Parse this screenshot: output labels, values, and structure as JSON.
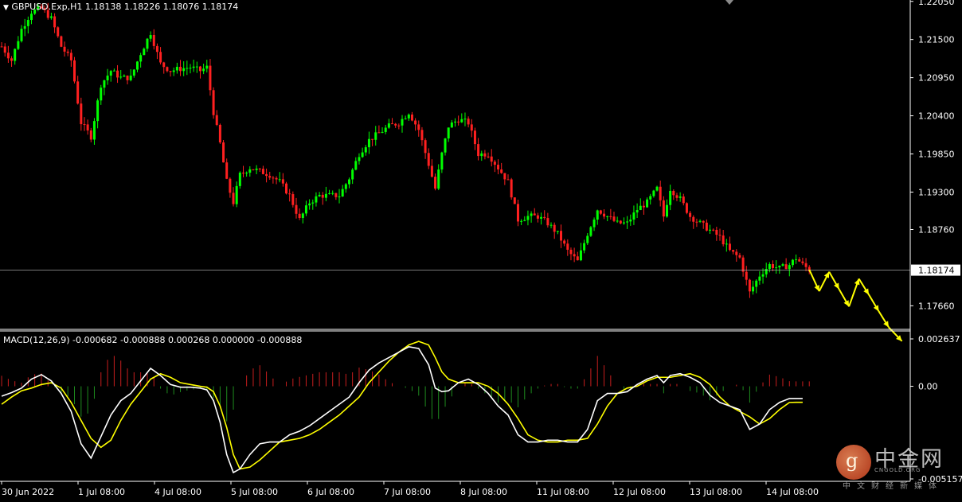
{
  "symbol_header": "GBPUSD.Exp,H1  1.18138 1.18226 1.18076 1.18174",
  "macd_header": "MACD(12,26,9) -0.000682 -0.000888 0.000268 0.000000 -0.000888",
  "current_price_label": "1.18174",
  "price_axis_labels": [
    "1.22050",
    "1.21500",
    "1.20950",
    "1.20400",
    "1.19850",
    "1.19300",
    "1.18760",
    "1.17660"
  ],
  "macd_axis_labels": [
    "0.002637",
    "0.00",
    "-0.005157"
  ],
  "time_labels": [
    "30 Jun 2022",
    "1 Jul 08:00",
    "4 Jul 08:00",
    "5 Jul 08:00",
    "6 Jul 08:00",
    "7 Jul 08:00",
    "8 Jul 08:00",
    "11 Jul 08:00",
    "12 Jul 08:00",
    "13 Jul 08:00",
    "14 Jul 08:00"
  ],
  "watermark": {
    "brand": "中金网",
    "glyph": "g",
    "domain": "CNGOLD.ORG",
    "slogan": "中文财经新媒体"
  },
  "colors": {
    "bull": "#00ff00",
    "bear": "#ff2020",
    "macd_main": "#ffffff",
    "macd_signal": "#ffff00",
    "hist_pos": "#c81e1e",
    "hist_neg": "#1e8c1e",
    "forecast": "#ffff00",
    "axis": "#ffffff",
    "price_line": "#c0c0c0"
  },
  "chart_data": [
    {
      "type": "candlestick",
      "title": "GBPUSD.Exp,H1",
      "y_axis_labels": [
        "1.22050",
        "1.21500",
        "1.20950",
        "1.20400",
        "1.19850",
        "1.19300",
        "1.18760",
        "1.17660"
      ],
      "ylim": [
        1.1732,
        1.2207
      ],
      "x_tick_labels": [
        "30 Jun 2022",
        "1 Jul 08:00",
        "4 Jul 08:00",
        "5 Jul 08:00",
        "6 Jul 08:00",
        "7 Jul 08:00",
        "8 Jul 08:00",
        "11 Jul 08:00",
        "12 Jul 08:00",
        "13 Jul 08:00",
        "14 Jul 08:00"
      ],
      "last_bar": {
        "open": 1.18138,
        "high": 1.18226,
        "low": 1.18076,
        "close": 1.18174
      },
      "current_price": 1.18174,
      "close_path": [
        [
          0,
          1.214
        ],
        [
          3,
          1.212
        ],
        [
          6,
          1.2165
        ],
        [
          9,
          1.219
        ],
        [
          12,
          1.2195
        ],
        [
          15,
          1.218
        ],
        [
          18,
          1.214
        ],
        [
          21,
          1.212
        ],
        [
          24,
          1.203
        ],
        [
          27,
          1.201
        ],
        [
          30,
          1.2085
        ],
        [
          33,
          1.2105
        ],
        [
          36,
          1.2095
        ],
        [
          39,
          1.2095
        ],
        [
          42,
          1.213
        ],
        [
          45,
          1.216
        ],
        [
          48,
          1.2115
        ],
        [
          51,
          1.2105
        ],
        [
          54,
          1.2108
        ],
        [
          57,
          1.211
        ],
        [
          60,
          1.2105
        ],
        [
          62,
          1.211
        ],
        [
          64,
          1.2045
        ],
        [
          66,
          1.2
        ],
        [
          68,
          1.1945
        ],
        [
          70,
          1.1915
        ],
        [
          72,
          1.1955
        ],
        [
          75,
          1.1965
        ],
        [
          78,
          1.196
        ],
        [
          81,
          1.1955
        ],
        [
          84,
          1.1945
        ],
        [
          87,
          1.1925
        ],
        [
          90,
          1.189
        ],
        [
          93,
          1.1915
        ],
        [
          96,
          1.1925
        ],
        [
          99,
          1.1925
        ],
        [
          102,
          1.1925
        ],
        [
          105,
          1.195
        ],
        [
          108,
          1.1985
        ],
        [
          111,
          1.2005
        ],
        [
          114,
          1.2015
        ],
        [
          117,
          1.2025
        ],
        [
          120,
          1.203
        ],
        [
          123,
          1.2045
        ],
        [
          126,
          1.202
        ],
        [
          129,
          1.197
        ],
        [
          131,
          1.1935
        ],
        [
          133,
          1.1985
        ],
        [
          135,
          1.2025
        ],
        [
          138,
          1.2035
        ],
        [
          141,
          1.203
        ],
        [
          144,
          1.1985
        ],
        [
          147,
          1.1985
        ],
        [
          150,
          1.1965
        ],
        [
          153,
          1.1945
        ],
        [
          156,
          1.189
        ],
        [
          159,
          1.1895
        ],
        [
          162,
          1.1895
        ],
        [
          165,
          1.1885
        ],
        [
          168,
          1.187
        ],
        [
          171,
          1.1845
        ],
        [
          174,
          1.183
        ],
        [
          177,
          1.187
        ],
        [
          180,
          1.1905
        ],
        [
          183,
          1.1895
        ],
        [
          186,
          1.1885
        ],
        [
          189,
          1.1885
        ],
        [
          192,
          1.1905
        ],
        [
          195,
          1.1915
        ],
        [
          198,
          1.1935
        ],
        [
          200,
          1.1895
        ],
        [
          202,
          1.1935
        ],
        [
          205,
          1.192
        ],
        [
          208,
          1.1895
        ],
        [
          211,
          1.1885
        ],
        [
          214,
          1.1875
        ],
        [
          217,
          1.1865
        ],
        [
          220,
          1.1845
        ],
        [
          223,
          1.1835
        ],
        [
          226,
          1.1785
        ],
        [
          229,
          1.181
        ],
        [
          232,
          1.1825
        ],
        [
          235,
          1.182
        ],
        [
          238,
          1.1825
        ],
        [
          240,
          1.1835
        ],
        [
          242,
          1.1825
        ],
        [
          244,
          1.1818
        ]
      ],
      "forecast_path": [
        [
          244,
          1.1818
        ],
        [
          247,
          1.1787
        ],
        [
          250,
          1.1815
        ],
        [
          253,
          1.179
        ],
        [
          256,
          1.1765
        ],
        [
          259,
          1.1805
        ],
        [
          262,
          1.1782
        ],
        [
          265,
          1.1758
        ],
        [
          268,
          1.1735
        ],
        [
          272,
          1.1715
        ]
      ]
    },
    {
      "type": "line",
      "title": "MACD(12,26,9)",
      "y_axis_labels": [
        "0.002637",
        "0.00",
        "-0.005157"
      ],
      "ylim": [
        -0.005157,
        0.002637
      ],
      "series": [
        {
          "name": "MACD",
          "values": [
            [
              0,
              -0.00055
            ],
            [
              3,
              -0.00035
            ],
            [
              6,
              -0.0001
            ],
            [
              9,
              0.0004
            ],
            [
              12,
              0.00065
            ],
            [
              15,
              0.0003
            ],
            [
              18,
              -0.0004
            ],
            [
              21,
              -0.0014
            ],
            [
              24,
              -0.0032
            ],
            [
              27,
              -0.004
            ],
            [
              30,
              -0.0028
            ],
            [
              33,
              -0.0016
            ],
            [
              36,
              -0.0008
            ],
            [
              39,
              -0.0004
            ],
            [
              42,
              0.0003
            ],
            [
              45,
              0.001
            ],
            [
              48,
              0.0006
            ],
            [
              51,
              0.0001
            ],
            [
              54,
              -5e-05
            ],
            [
              57,
              -5e-05
            ],
            [
              60,
              -0.0001
            ],
            [
              62,
              -0.0002
            ],
            [
              64,
              -0.0008
            ],
            [
              66,
              -0.002
            ],
            [
              68,
              -0.0038
            ],
            [
              70,
              -0.0048
            ],
            [
              72,
              -0.0046
            ],
            [
              75,
              -0.0038
            ],
            [
              78,
              -0.0032
            ],
            [
              81,
              -0.0031
            ],
            [
              84,
              -0.0031
            ],
            [
              87,
              -0.0027
            ],
            [
              90,
              -0.0025
            ],
            [
              93,
              -0.0022
            ],
            [
              96,
              -0.0018
            ],
            [
              99,
              -0.0014
            ],
            [
              102,
              -0.001
            ],
            [
              105,
              -0.0006
            ],
            [
              108,
              0.0002
            ],
            [
              111,
              0.0009
            ],
            [
              114,
              0.0013
            ],
            [
              117,
              0.0016
            ],
            [
              120,
              0.0019
            ],
            [
              123,
              0.0022
            ],
            [
              126,
              0.0021
            ],
            [
              129,
              0.0012
            ],
            [
              131,
              -0.0001
            ],
            [
              133,
              -0.0003
            ],
            [
              135,
              -0.00025
            ],
            [
              138,
              0.0002
            ],
            [
              141,
              0.0004
            ],
            [
              144,
              0.0001
            ],
            [
              147,
              -0.0004
            ],
            [
              150,
              -0.0011
            ],
            [
              153,
              -0.0016
            ],
            [
              156,
              -0.0027
            ],
            [
              159,
              -0.0031
            ],
            [
              162,
              -0.0031
            ],
            [
              165,
              -0.003
            ],
            [
              168,
              -0.003
            ],
            [
              171,
              -0.0031
            ],
            [
              174,
              -0.0031
            ],
            [
              177,
              -0.0024
            ],
            [
              180,
              -0.0008
            ],
            [
              183,
              -0.0004
            ],
            [
              186,
              -0.0004
            ],
            [
              189,
              -0.0003
            ],
            [
              192,
              0.0001
            ],
            [
              195,
              0.0004
            ],
            [
              198,
              0.0006
            ],
            [
              200,
              0.0002
            ],
            [
              202,
              0.0006
            ],
            [
              205,
              0.0007
            ],
            [
              208,
              0.0005
            ],
            [
              211,
              0.0002
            ],
            [
              214,
              -0.0005
            ],
            [
              217,
              -0.0009
            ],
            [
              220,
              -0.0011
            ],
            [
              223,
              -0.0013
            ],
            [
              226,
              -0.0024
            ],
            [
              229,
              -0.0021
            ],
            [
              232,
              -0.0013
            ],
            [
              235,
              -0.0009
            ],
            [
              238,
              -0.00068
            ],
            [
              240,
              -0.00068
            ],
            [
              242,
              -0.00068
            ]
          ]
        },
        {
          "name": "Signal",
          "values": [
            [
              0,
              -0.001
            ],
            [
              3,
              -0.0006
            ],
            [
              6,
              -0.00025
            ],
            [
              9,
              -0.0001
            ],
            [
              12,
              0.0001
            ],
            [
              15,
              0.0002
            ],
            [
              18,
              -0.0001
            ],
            [
              21,
              -0.0009
            ],
            [
              24,
              -0.0019
            ],
            [
              27,
              -0.0029
            ],
            [
              30,
              -0.0034
            ],
            [
              33,
              -0.003
            ],
            [
              36,
              -0.0019
            ],
            [
              39,
              -0.001
            ],
            [
              42,
              -0.0003
            ],
            [
              45,
              0.0004
            ],
            [
              48,
              0.0007
            ],
            [
              51,
              0.0005
            ],
            [
              54,
              0.0002
            ],
            [
              57,
              0.0001
            ],
            [
              60,
              0.0
            ],
            [
              62,
              -5e-05
            ],
            [
              64,
              -0.0003
            ],
            [
              66,
              -0.0011
            ],
            [
              68,
              -0.0023
            ],
            [
              70,
              -0.0038
            ],
            [
              72,
              -0.0046
            ],
            [
              75,
              -0.0045
            ],
            [
              78,
              -0.0041
            ],
            [
              81,
              -0.0036
            ],
            [
              84,
              -0.0031
            ],
            [
              87,
              -0.003
            ],
            [
              90,
              -0.0029
            ],
            [
              93,
              -0.0027
            ],
            [
              96,
              -0.0024
            ],
            [
              99,
              -0.002
            ],
            [
              102,
              -0.0016
            ],
            [
              105,
              -0.0011
            ],
            [
              108,
              -0.0006
            ],
            [
              111,
              0.0002
            ],
            [
              114,
              0.0008
            ],
            [
              117,
              0.0014
            ],
            [
              120,
              0.0019
            ],
            [
              123,
              0.0023
            ],
            [
              126,
              0.0025
            ],
            [
              129,
              0.0023
            ],
            [
              131,
              0.0016
            ],
            [
              133,
              0.0008
            ],
            [
              135,
              0.0004
            ],
            [
              138,
              0.0002
            ],
            [
              141,
              0.0002
            ],
            [
              144,
              0.0002
            ],
            [
              147,
              0.0
            ],
            [
              150,
              -0.0004
            ],
            [
              153,
              -0.001
            ],
            [
              156,
              -0.0018
            ],
            [
              159,
              -0.0027
            ],
            [
              162,
              -0.003
            ],
            [
              165,
              -0.0031
            ],
            [
              168,
              -0.0031
            ],
            [
              171,
              -0.003
            ],
            [
              174,
              -0.003
            ],
            [
              177,
              -0.0029
            ],
            [
              180,
              -0.0021
            ],
            [
              183,
              -0.0011
            ],
            [
              186,
              -0.0004
            ],
            [
              189,
              -0.0001
            ],
            [
              192,
              0.0
            ],
            [
              195,
              0.0003
            ],
            [
              198,
              0.0005
            ],
            [
              200,
              0.0005
            ],
            [
              202,
              0.0005
            ],
            [
              205,
              0.0006
            ],
            [
              208,
              0.0007
            ],
            [
              211,
              0.0005
            ],
            [
              214,
              0.0001
            ],
            [
              217,
              -0.0006
            ],
            [
              220,
              -0.0011
            ],
            [
              223,
              -0.0014
            ],
            [
              226,
              -0.0017
            ],
            [
              229,
              -0.0021
            ],
            [
              232,
              -0.0018
            ],
            [
              235,
              -0.0013
            ],
            [
              238,
              -0.0009
            ],
            [
              240,
              -0.00089
            ],
            [
              242,
              -0.00089
            ]
          ]
        }
      ]
    }
  ]
}
